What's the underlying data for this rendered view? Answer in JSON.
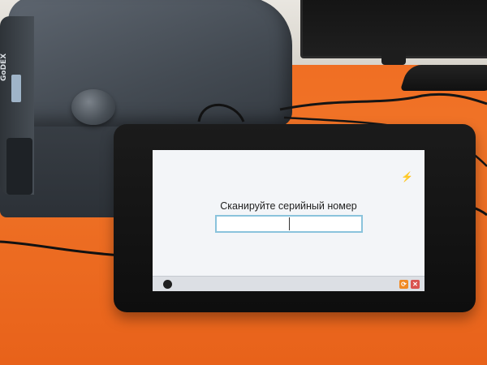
{
  "printer": {
    "logo": "GoDEX"
  },
  "screen": {
    "prompt": "Сканируйте серийный номер",
    "serial_value": "",
    "status_icon": "lightning-bolt-icon"
  },
  "taskbar": {
    "start_icon": "round-menu-icon",
    "refresh_icon": "refresh-icon",
    "close_icon": "close-icon"
  }
}
